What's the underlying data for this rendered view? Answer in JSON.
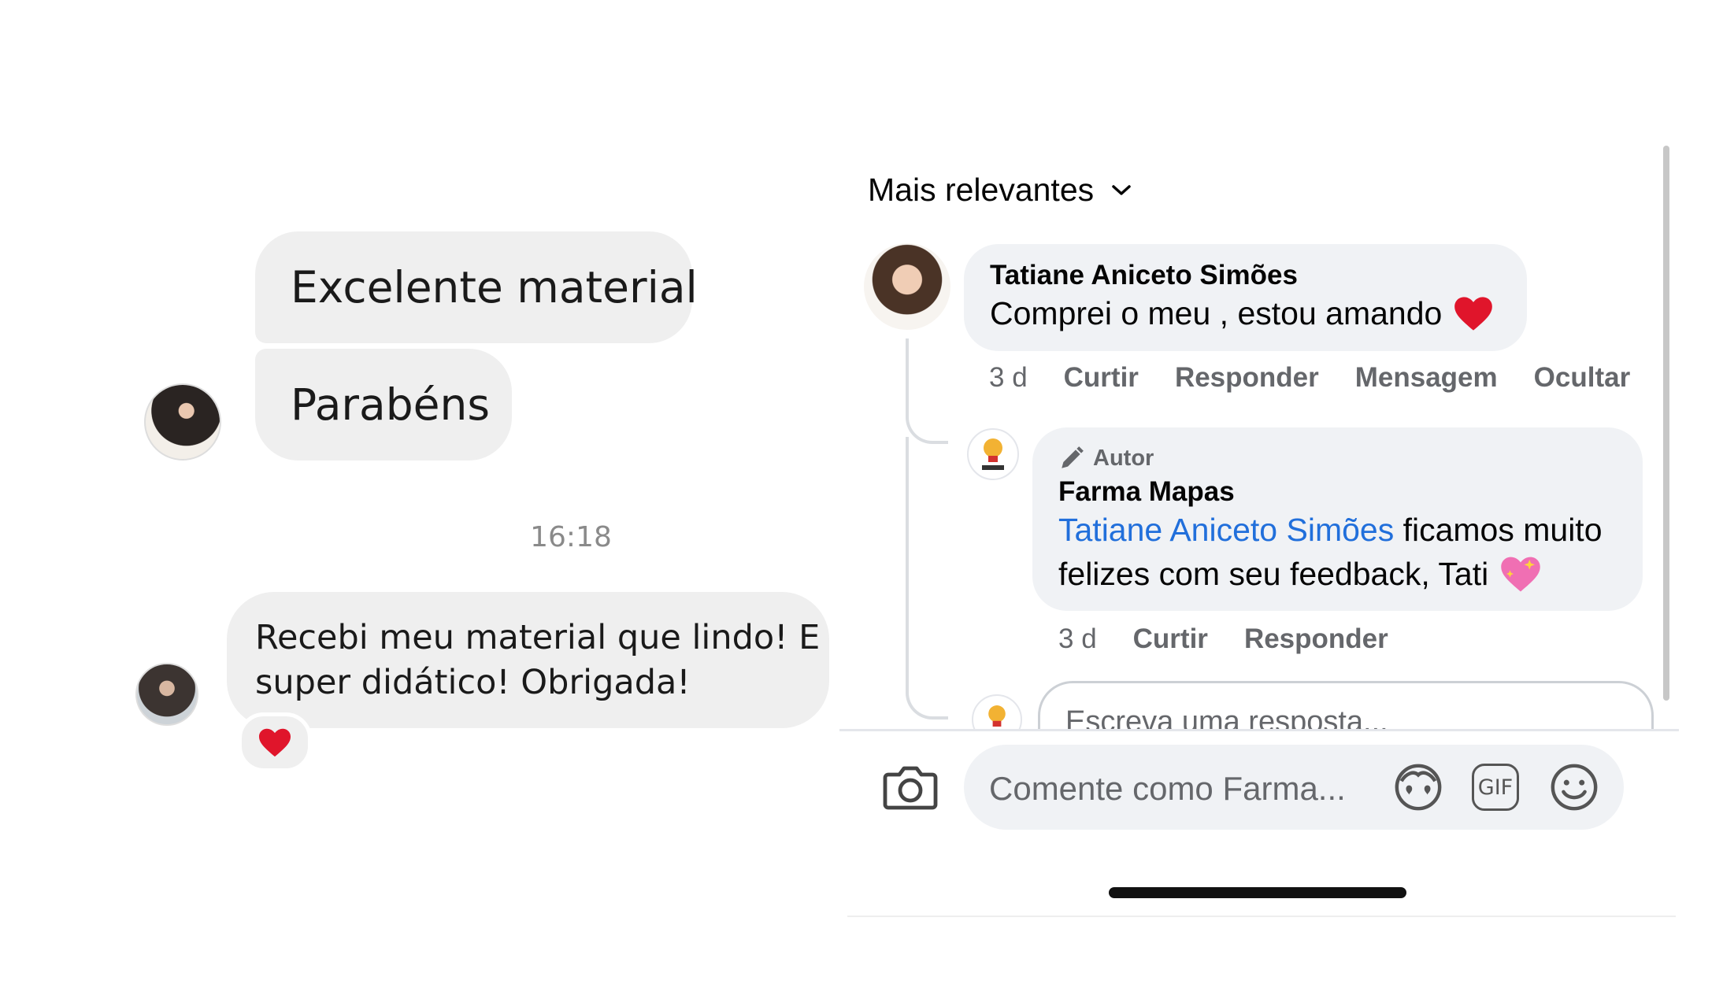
{
  "left_chat": {
    "messages": [
      {
        "text": "Excelente material"
      },
      {
        "text": "Parabéns"
      },
      {
        "text": "Recebi meu material que lindo! E super didático! Obrigada!"
      }
    ],
    "timestamp": "16:18",
    "reaction": "heart"
  },
  "fb": {
    "sort_label": "Mais relevantes",
    "comment": {
      "author": "Tatiane Aniceto Simões",
      "text": "Comprei o meu , estou amando",
      "age": "3 d",
      "actions": [
        "Curtir",
        "Responder",
        "Mensagem",
        "Ocultar"
      ]
    },
    "reply": {
      "badge": "Autor",
      "author": "Farma Mapas",
      "mention": "Tatiane Aniceto Simões",
      "text_line1": " ficamos muito",
      "text_line2": "felizes com seu feedback, Tati",
      "age": "3 d",
      "actions": [
        "Curtir",
        "Responder"
      ]
    },
    "reply_placeholder": "Escreva uma resposta...",
    "comment_placeholder": "Comente como Farma...",
    "gif_label": "GIF",
    "colors": {
      "bubble": "#f0f2f5",
      "mention": "#216fdb",
      "heart": "#e0152b"
    }
  }
}
